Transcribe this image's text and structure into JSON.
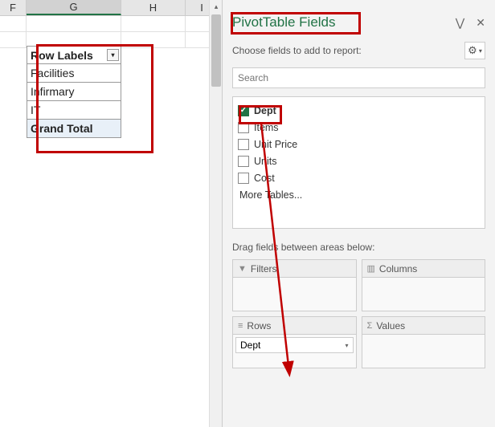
{
  "columns": {
    "F": "F",
    "G": "G",
    "H": "H",
    "I": "I"
  },
  "pivot_table": {
    "header": "Row Labels",
    "rows": [
      "Facilities",
      "Infirmary",
      "IT"
    ],
    "total": "Grand Total"
  },
  "pane": {
    "title": "PivotTable Fields",
    "subtitle": "Choose fields to add to report:",
    "search_placeholder": "Search",
    "fields": [
      {
        "label": "Dept",
        "checked": true,
        "bold": true
      },
      {
        "label": "Items",
        "checked": false,
        "bold": false
      },
      {
        "label": "Unit Price",
        "checked": false,
        "bold": false
      },
      {
        "label": "Units",
        "checked": false,
        "bold": false
      },
      {
        "label": "Cost",
        "checked": false,
        "bold": false
      }
    ],
    "more_tables": "More Tables...",
    "drag_label": "Drag fields between areas below:",
    "areas": {
      "filters": "Filters",
      "columns": "Columns",
      "rows": "Rows",
      "values": "Values",
      "rows_item": "Dept"
    }
  }
}
